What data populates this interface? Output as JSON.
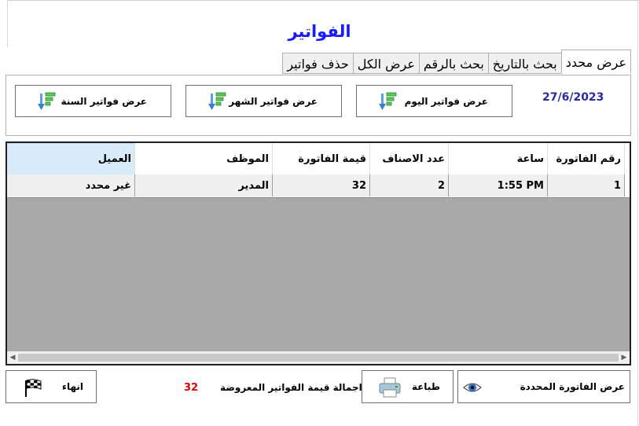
{
  "window": {
    "title": "الفواتير"
  },
  "tabs": [
    {
      "label": "عرض محدد",
      "active": true
    },
    {
      "label": "بحث بالتاريخ",
      "active": false
    },
    {
      "label": "بحث بالرقم",
      "active": false
    },
    {
      "label": "عرض الكل",
      "active": false
    },
    {
      "label": "حذف فواتير",
      "active": false
    }
  ],
  "filter_panel": {
    "date": "27/6/2023",
    "today_button": "عرض فواتير اليوم",
    "month_button": "عرض فواتير الشهر",
    "year_button": "عرض فواتير السنة",
    "button_icon": "sort-descending-icon"
  },
  "grid": {
    "columns": [
      "رقم الفاتورة",
      "ساعة",
      "عدد الاصناف",
      "قيمة الفاتورة",
      "الموظف",
      "العميل"
    ],
    "rows": [
      [
        "1",
        "1:55 PM",
        "2",
        "32",
        "المدير",
        "غير محدد"
      ]
    ]
  },
  "footer": {
    "view_invoice_button": "عرض الفاتورة المحددة",
    "print_button": "طباعة",
    "total_label": "اجمالة قيمة الفواتير المعروضة",
    "total_value": "32",
    "exit_button": "انهاء"
  },
  "colors": {
    "title": "#1a1aff",
    "date": "#2a2aa0",
    "total": "#e00000",
    "grid_background": "#a9a9a9",
    "selected_header": "#d8ebf8"
  }
}
